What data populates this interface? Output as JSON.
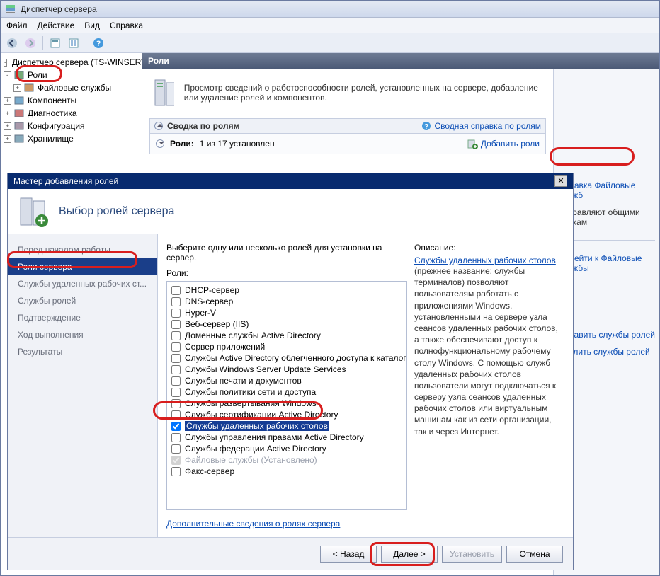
{
  "mainWindow": {
    "title": "Диспетчер сервера",
    "menus": [
      "Файл",
      "Действие",
      "Вид",
      "Справка"
    ]
  },
  "tree": {
    "root": "Диспетчер сервера (TS-WINSERV",
    "nodes": [
      {
        "label": "Роли",
        "exp": "-"
      },
      {
        "label": "Файловые службы",
        "exp": "+",
        "indent": true
      },
      {
        "label": "Компоненты",
        "exp": "+"
      },
      {
        "label": "Диагностика",
        "exp": "+"
      },
      {
        "label": "Конфигурация",
        "exp": "+"
      },
      {
        "label": "Хранилище",
        "exp": "+"
      }
    ]
  },
  "content": {
    "header": "Роли",
    "bannerText": "Просмотр сведений о работоспособности ролей, установленных на сервере, добавление или удаление ролей и компонентов.",
    "summaryTitle": "Сводка по ролям",
    "summaryHelp": "Сводная справка по ролям",
    "rolesCountLabel": "Роли:",
    "rolesCountValue": "1 из 17 установлен",
    "addRoles": "Добавить роли"
  },
  "sideActions": {
    "help1": "Справка Файловые служб",
    "desc1": ", управляют общими папкам",
    "go1": "Перейти к Файловые службы",
    "addServices": "Добавить службы ролей",
    "removeServices": "Удалить службы ролей"
  },
  "wizard": {
    "title": "Мастер добавления ролей",
    "heading": "Выбор ролей сервера",
    "steps": [
      "Перед началом работы",
      "Роли сервера",
      "Службы удаленных рабочих ст...",
      "Службы ролей",
      "Подтверждение",
      "Ход выполнения",
      "Результаты"
    ],
    "activeStep": 1,
    "instruction": "Выберите одну или несколько ролей для установки на сервер.",
    "rolesLabel": "Роли:",
    "roles": [
      {
        "label": "DHCP-сервер"
      },
      {
        "label": "DNS-сервер"
      },
      {
        "label": "Hyper-V"
      },
      {
        "label": "Веб-сервер (IIS)"
      },
      {
        "label": "Доменные службы Active Directory"
      },
      {
        "label": "Сервер приложений"
      },
      {
        "label": "Службы Active Directory облегченного доступа к каталогам"
      },
      {
        "label": "Службы Windows Server Update Services"
      },
      {
        "label": "Службы печати и документов"
      },
      {
        "label": "Службы политики сети и доступа"
      },
      {
        "label": "Службы развертывания Windows"
      },
      {
        "label": "Службы сертификации Active Directory"
      },
      {
        "label": "Службы удаленных рабочих столов",
        "checked": true,
        "selected": true
      },
      {
        "label": "Службы управления правами Active Directory"
      },
      {
        "label": "Службы федерации Active Directory"
      },
      {
        "label": "Файловые службы (Установлено)",
        "disabled": true,
        "checked": true
      },
      {
        "label": "Факс-сервер"
      }
    ],
    "moreLink": "Дополнительные сведения о ролях сервера",
    "descTitle": "Описание:",
    "descLink": "Службы удаленных рабочих столов",
    "descBody": "(прежнее название: службы терминалов) позволяют пользователям работать с приложениями Windows, установленными на сервере узла сеансов удаленных рабочих столов, а также обеспечивают доступ к полнофункциональному рабочему столу Windows. С помощью служб удаленных рабочих столов пользователи могут подключаться к серверу узла сеансов удаленных рабочих столов или виртуальным машинам как из сети организации, так и через Интернет.",
    "buttons": {
      "back": "< Назад",
      "next": "Далее >",
      "install": "Установить",
      "cancel": "Отмена"
    }
  }
}
